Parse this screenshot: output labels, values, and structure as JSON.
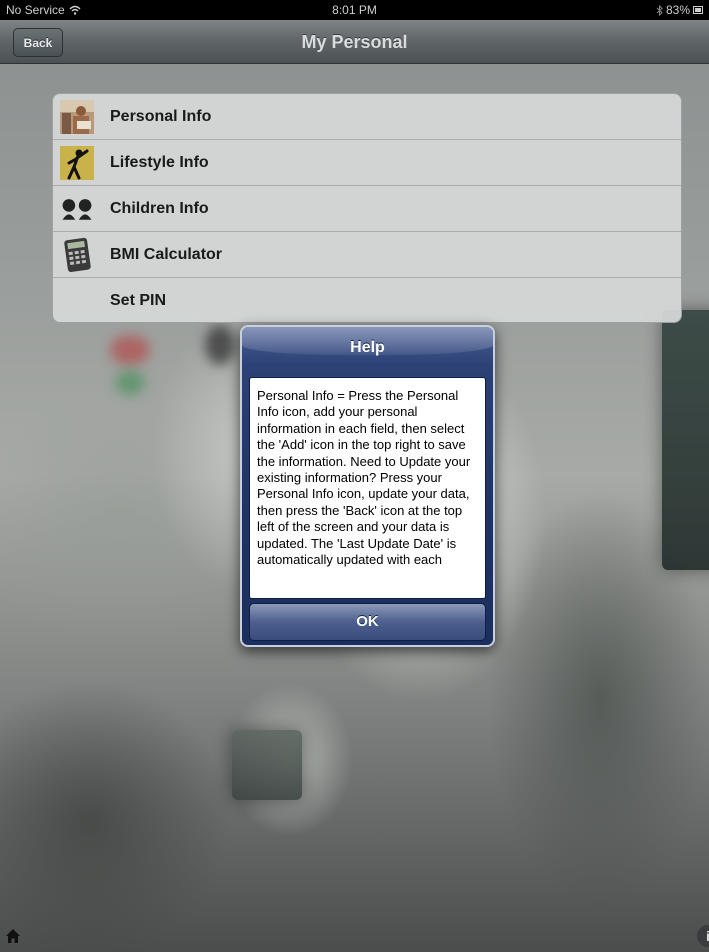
{
  "status_bar": {
    "carrier": "No Service",
    "time": "8:01 PM",
    "battery": "83%"
  },
  "nav": {
    "back_label": "Back",
    "title": "My Personal"
  },
  "menu": {
    "items": [
      {
        "label": "Personal Info",
        "icon": "person-photo-icon"
      },
      {
        "label": "Lifestyle Info",
        "icon": "exercise-figure-icon"
      },
      {
        "label": "Children Info",
        "icon": "children-heads-icon"
      },
      {
        "label": "BMI Calculator",
        "icon": "calculator-icon"
      },
      {
        "label": "Set PIN",
        "icon": ""
      }
    ]
  },
  "alert": {
    "title": "Help",
    "body": "Personal Info = Press the Personal Info icon, add your personal information in each field, then select the 'Add' icon in the top right to save the information. Need to Update your existing information?  Press your Personal Info icon, update your data, then press the 'Back' icon at the top left of the screen and your data is updated.  The 'Last Update Date' is automatically updated with each",
    "ok_label": "OK"
  },
  "bottom": {
    "home_icon": "home-icon",
    "info_icon": "info-icon",
    "info_glyph": "i"
  },
  "colors": {
    "alert_blue": "#1d3366",
    "nav_gray": "#5f6467"
  }
}
